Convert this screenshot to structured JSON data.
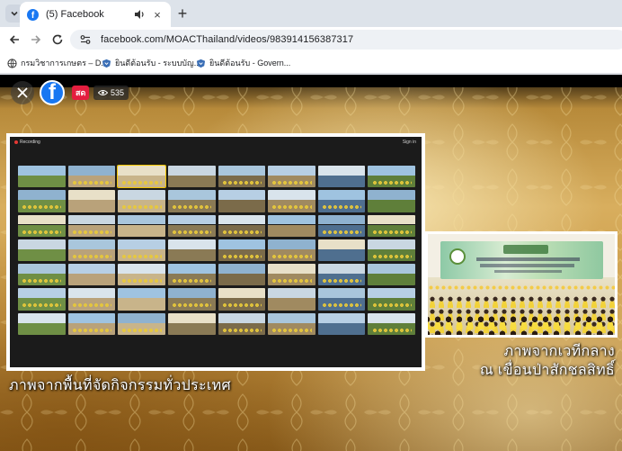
{
  "browser": {
    "tab_title": "(5) Facebook",
    "new_tab_symbol": "+",
    "close_symbol": "×",
    "url": "facebook.com/MOACThailand/videos/983914156387317",
    "bookmarks": [
      {
        "label": "กรมวิชาการเกษตร – D...",
        "icon": "globe-icon"
      },
      {
        "label": "ยินดีต้อนรับ - ระบบบัญ...",
        "icon": "bookmark-site-icon"
      },
      {
        "label": "ยินดีต้อนรับ - Govern...",
        "icon": "bookmark-site-icon"
      }
    ]
  },
  "video": {
    "live_label": "สด",
    "viewer_count": "535",
    "zoom": {
      "recording_label": "Recording",
      "signin_label": "Sign in"
    },
    "caption_left": "ภาพจากพื้นที่จัดกิจกรรมทั่วประเทศ",
    "caption_right_line1": "ภาพจากเวทีกลาง",
    "caption_right_line2": "ณ เขื่อนป่าสักชลสิทธิ์"
  },
  "colors": {
    "facebook_blue": "#1877f2",
    "live_red": "#e41e3f",
    "gold_background": "#d8ae5e"
  }
}
